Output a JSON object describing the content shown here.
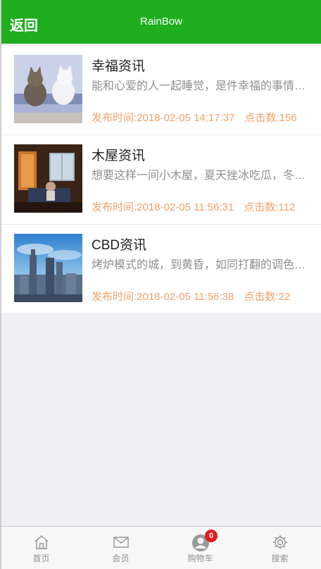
{
  "header": {
    "back_label": "返回",
    "title": "RainBow"
  },
  "news": [
    {
      "title": "幸福资讯",
      "desc": "能和心爱的人一起睡觉，是件幸福的事情；可是打呼噜怎么办？",
      "time": "发布时间:2018-02-05 14:17:37",
      "clicks": "点击数:156"
    },
    {
      "title": "木屋资讯",
      "desc": "想要这样一间小木屋，夏天挫冰吃瓜，冬天围炉取暖。",
      "time": "发布时间:2018-02-05 11:56:31",
      "clicks": "点击数:112"
    },
    {
      "title": "CBD资讯",
      "desc": "烤炉模式的城，到黄昏，如同打翻的调色盘一般。",
      "time": "发布时间:2018-02-05 11:56:38",
      "clicks": "点击数:22"
    }
  ],
  "tabbar": {
    "items": [
      {
        "label": "首页",
        "icon": "home-icon"
      },
      {
        "label": "会员",
        "icon": "mail-icon"
      },
      {
        "label": "购物车",
        "icon": "cart-icon",
        "badge": "0"
      },
      {
        "label": "搜索",
        "icon": "gear-icon"
      }
    ]
  },
  "colors": {
    "brand": "#1eae20",
    "meta": "#f0a26a",
    "badge": "#e31b1b"
  }
}
